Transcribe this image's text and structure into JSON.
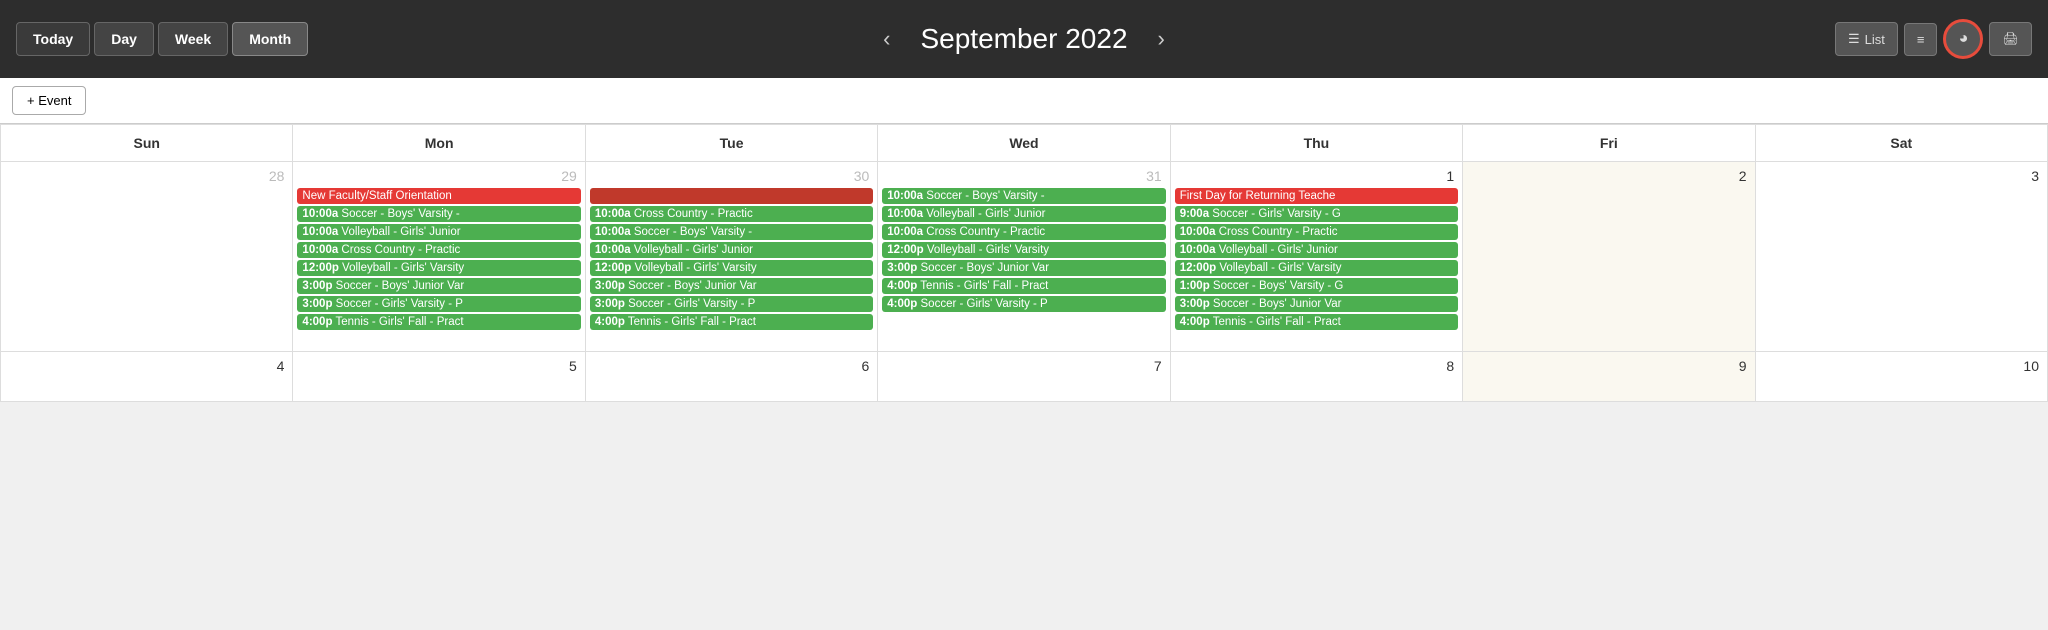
{
  "header": {
    "today_label": "Today",
    "day_label": "Day",
    "week_label": "Week",
    "month_label": "Month",
    "prev_arrow": "‹",
    "next_arrow": "›",
    "title": "September 2022",
    "list_label": "List",
    "active_view": "Month"
  },
  "toolbar": {
    "add_event_label": "+ Event"
  },
  "calendar": {
    "days": [
      "Sun",
      "Mon",
      "Tue",
      "Wed",
      "Thu",
      "Fri",
      "Sat"
    ],
    "weeks": [
      {
        "dates": [
          {
            "num": "28",
            "type": "gray"
          },
          {
            "num": "29",
            "type": "gray"
          },
          {
            "num": "30",
            "type": "gray"
          },
          {
            "num": "31",
            "type": "gray"
          },
          {
            "num": "1",
            "type": "active"
          },
          {
            "num": "2",
            "type": "active"
          },
          {
            "num": "3",
            "type": "active"
          }
        ]
      },
      {
        "dates": [
          {
            "num": "4",
            "type": "active"
          },
          {
            "num": "5",
            "type": "active"
          },
          {
            "num": "6",
            "type": "active"
          },
          {
            "num": "7",
            "type": "active"
          },
          {
            "num": "8",
            "type": "active"
          },
          {
            "num": "9",
            "type": "active"
          },
          {
            "num": "10",
            "type": "active"
          }
        ]
      }
    ]
  },
  "week1_events": {
    "sun": [],
    "mon": [
      {
        "time": "10:00a",
        "text": "Soccer - Boys' Varsity -",
        "color": "green"
      },
      {
        "time": "10:00a",
        "text": "Volleyball - Girls' Junior",
        "color": "green"
      },
      {
        "time": "10:00a",
        "text": "Cross Country - Practic",
        "color": "green"
      },
      {
        "time": "12:00p",
        "text": "Volleyball - Girls' Varsity",
        "color": "green"
      },
      {
        "time": "3:00p",
        "text": "Soccer - Boys' Junior Var",
        "color": "green"
      },
      {
        "time": "3:00p",
        "text": "Soccer - Girls' Varsity - P",
        "color": "green"
      },
      {
        "time": "4:00p",
        "text": "Tennis - Girls' Fall - Pract",
        "color": "green"
      }
    ],
    "tue": [
      {
        "time": "10:00a",
        "text": "Cross Country - Practic",
        "color": "green"
      },
      {
        "time": "10:00a",
        "text": "Soccer - Boys' Varsity -",
        "color": "green"
      },
      {
        "time": "10:00a",
        "text": "Volleyball - Girls' Junior",
        "color": "green"
      },
      {
        "time": "12:00p",
        "text": "Volleyball - Girls' Varsity",
        "color": "green"
      },
      {
        "time": "3:00p",
        "text": "Soccer - Boys' Junior Var",
        "color": "green"
      },
      {
        "time": "3:00p",
        "text": "Soccer - Girls' Varsity - P",
        "color": "green"
      },
      {
        "time": "4:00p",
        "text": "Tennis - Girls' Fall - Pract",
        "color": "green"
      }
    ],
    "wed": [
      {
        "time": "10:00a",
        "text": "Soccer - Boys' Varsity -",
        "color": "green"
      },
      {
        "time": "10:00a",
        "text": "Volleyball - Girls' Junior",
        "color": "green"
      },
      {
        "time": "10:00a",
        "text": "Cross Country - Practic",
        "color": "green"
      },
      {
        "time": "12:00p",
        "text": "Volleyball - Girls' Varsity",
        "color": "green"
      },
      {
        "time": "3:00p",
        "text": "Soccer - Boys' Junior Var",
        "color": "green"
      },
      {
        "time": "4:00p",
        "text": "Tennis - Girls' Fall - Pract",
        "color": "green"
      },
      {
        "time": "4:00p",
        "text": "Soccer - Girls' Varsity - P",
        "color": "green"
      }
    ],
    "thu": [
      {
        "time": "First Day for Returning Teache",
        "text": "",
        "color": "red"
      },
      {
        "time": "9:00a",
        "text": "Soccer - Girls' Varsity - G",
        "color": "green"
      },
      {
        "time": "10:00a",
        "text": "Cross Country - Practic",
        "color": "green"
      },
      {
        "time": "10:00a",
        "text": "Volleyball - Girls' Junior",
        "color": "green"
      },
      {
        "time": "12:00p",
        "text": "Volleyball - Girls' Varsity",
        "color": "green"
      },
      {
        "time": "1:00p",
        "text": "Soccer - Boys' Varsity - G",
        "color": "green"
      },
      {
        "time": "3:00p",
        "text": "Soccer - Boys' Junior Var",
        "color": "green"
      },
      {
        "time": "4:00p",
        "text": "Tennis - Girls' Fall - Pract",
        "color": "green"
      }
    ],
    "fri": [],
    "sat": []
  }
}
